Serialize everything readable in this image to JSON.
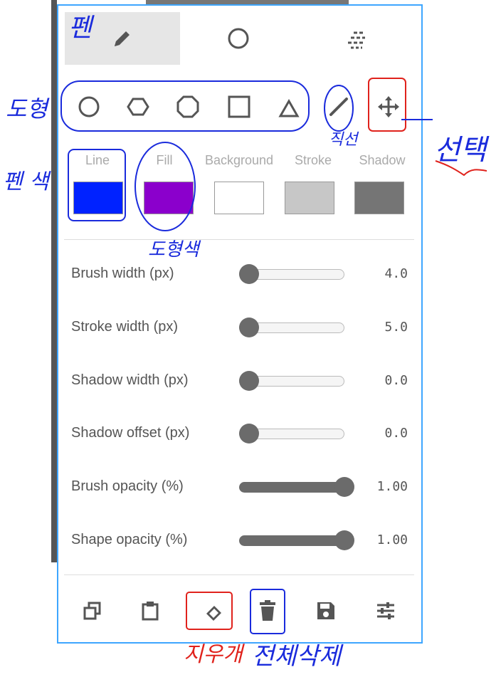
{
  "tabs": [
    {
      "name": "pen",
      "icon": "pencil-icon",
      "active": true
    },
    {
      "name": "shape",
      "icon": "circle-outline-icon",
      "active": false
    },
    {
      "name": "effects",
      "icon": "dashed-lines-icon",
      "active": false
    }
  ],
  "shape_tools": [
    {
      "icon": "circle-icon"
    },
    {
      "icon": "hexagon-icon"
    },
    {
      "icon": "octagon-icon"
    },
    {
      "icon": "square-icon"
    },
    {
      "icon": "triangle-icon"
    }
  ],
  "extra_tools": [
    {
      "icon": "line-icon"
    },
    {
      "icon": "move-icon"
    }
  ],
  "colors": [
    {
      "label": "Line",
      "color": "#0022ff"
    },
    {
      "label": "Fill",
      "color": "#8b00cc"
    },
    {
      "label": "Background",
      "color": "#ffffff"
    },
    {
      "label": "Stroke",
      "color": "#c7c7c7"
    },
    {
      "label": "Shadow",
      "color": "#757575"
    }
  ],
  "sliders": [
    {
      "label": "Brush width (px)",
      "value": "4.0",
      "level": 0.0
    },
    {
      "label": "Stroke width (px)",
      "value": "5.0",
      "level": 0.0
    },
    {
      "label": "Shadow width (px)",
      "value": "0.0",
      "level": 0.0
    },
    {
      "label": "Shadow offset (px)",
      "value": "0.0",
      "level": 0.0
    },
    {
      "label": "Brush opacity (%)",
      "value": "1.00",
      "level": 1.0
    },
    {
      "label": "Shape opacity (%)",
      "value": "1.00",
      "level": 1.0
    }
  ],
  "bottom_actions": [
    {
      "icon": "copy-icon"
    },
    {
      "icon": "clipboard-icon"
    },
    {
      "icon": "eraser-icon"
    },
    {
      "icon": "trash-icon"
    },
    {
      "icon": "save-icon"
    },
    {
      "icon": "sliders-icon"
    }
  ],
  "annotations": {
    "pen": "펜",
    "shape": "도형",
    "line": "직선",
    "select": "선택",
    "pen_color": "펜 색",
    "shape_color": "도형색",
    "eraser": "지우개",
    "delete_all": "전체삭제"
  },
  "accent_color": "#3ea6ff",
  "annotation_blue": "#1a2bdc",
  "annotation_red": "#e0221c"
}
